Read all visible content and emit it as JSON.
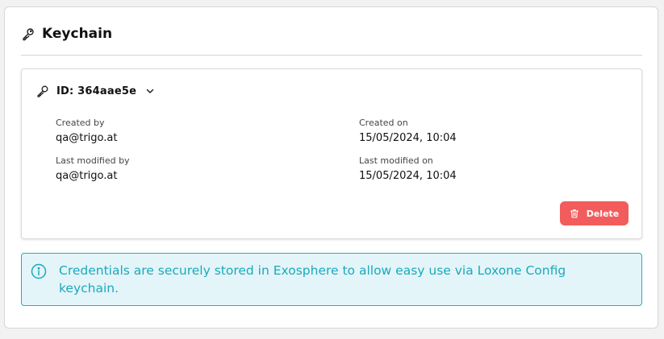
{
  "panel": {
    "title": "Keychain",
    "icon": "key-outline-icon"
  },
  "entry": {
    "id_label": "ID: 364aae5e",
    "created_by_label": "Created by",
    "created_by_value": "qa@trigo.at",
    "created_on_label": "Created on",
    "created_on_value": "15/05/2024, 10:04",
    "last_modified_by_label": "Last modified by",
    "last_modified_by_value": "qa@trigo.at",
    "last_modified_on_label": "Last modified on",
    "last_modified_on_value": "15/05/2024, 10:04",
    "delete_label": "Delete"
  },
  "info": {
    "message": "Credentials are securely stored in Exosphere to allow easy use via Loxone Config keychain."
  },
  "colors": {
    "delete": "#f25c5c",
    "info_border": "#21aec4",
    "info_background": "#e3f5f8",
    "info_text": "#1ba9be"
  }
}
